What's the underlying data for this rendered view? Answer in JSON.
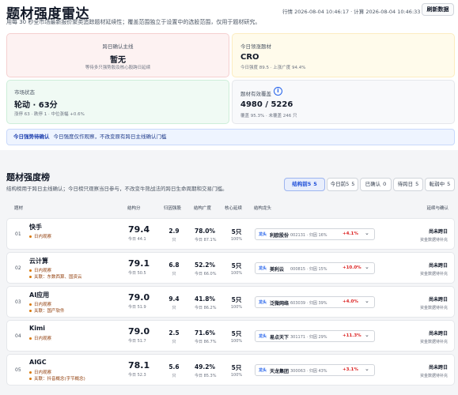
{
  "header": {
    "title": "题材强度雷达",
    "subtitle": "用每 30 秒全市场最新报价聚类追踪题材延续性；覆盖范围独立于设置中的选股范围，仅用于题材研究。",
    "meta": "行情 2026-08-04 10:46:17 · 计算 2026-08-04 10:46:33",
    "refresh_label": "刷新数据"
  },
  "cards": {
    "main_line": {
      "label": "跨日确认主线",
      "value": "暂无",
      "sub": "等待多只强势股及核心股跨日延续"
    },
    "leader": {
      "label": "今日领涨题材",
      "value": "CRO",
      "sub": "今日强度 89.5 · 上涨广度 94.4%"
    },
    "market": {
      "label": "市场状态",
      "value": "轮动 · 63分",
      "sub": "涨停 63 · 跌停 1 · 中位涨幅 +0.6%"
    },
    "coverage": {
      "label": "题材有效覆盖",
      "info_icon": "i",
      "value": "4980 / 5226",
      "sub": "覆盖 95.3% · 未覆盖 246 只"
    }
  },
  "notice": {
    "bold": "今日强势待确认",
    "text": "今日强度仅作观察，不改变原有跨日主线确认门槛"
  },
  "ranking": {
    "title": "题材强度榜",
    "subtitle": "结构榜用于跨日主线确认；今日榜只观察当日参与，不改变牛熊战法的跨日生命周期和交易门槛。",
    "tabs": [
      {
        "label": "结构前5",
        "count": "5",
        "active": true
      },
      {
        "label": "今日前5",
        "count": "5",
        "active": false
      },
      {
        "label": "已确认",
        "count": "0",
        "active": false
      },
      {
        "label": "待跨日",
        "count": "5",
        "active": false
      },
      {
        "label": "転弱中",
        "count": "5",
        "active": false
      }
    ],
    "columns": {
      "theme": "题材",
      "score": "结构分",
      "retention": "归因强股",
      "breadth": "结构广度",
      "continuation": "核心延续",
      "leader": "结构龙头",
      "status": "延续与确认"
    },
    "rows": [
      {
        "idx": "01",
        "name": "快手",
        "tags": [
          "日内观察"
        ],
        "score": "79.4",
        "score_today": "今日 44.1",
        "retention": "2.9",
        "retention_unit": "只",
        "breadth": "78.0%",
        "breadth_today": "今日 87.1%",
        "cont": "5只",
        "cont_sub": "100%",
        "leader_badge": "龙头",
        "leader_name": "利欧股份",
        "leader_meta": "002131 · 归因 16%",
        "leader_chg": "+4.1%",
        "status": "尚未跨日",
        "status_sub": "资金数据待补充"
      },
      {
        "idx": "02",
        "name": "云计算",
        "tags": [
          "日内观察",
          "关联：东数西算、国资云"
        ],
        "score": "79.1",
        "score_today": "今日 50.5",
        "retention": "6.8",
        "retention_unit": "只",
        "breadth": "52.2%",
        "breadth_today": "今日 66.0%",
        "cont": "5只",
        "cont_sub": "100%",
        "leader_badge": "龙头",
        "leader_name": "美利云",
        "leader_meta": "000815 · 归因 15%",
        "leader_chg": "+10.0%",
        "status": "尚未跨日",
        "status_sub": "资金数据待补充"
      },
      {
        "idx": "03",
        "name": "AI应用",
        "tags": [
          "日内观察",
          "关联：国产软件"
        ],
        "score": "79.0",
        "score_today": "今日 51.9",
        "retention": "9.4",
        "retention_unit": "只",
        "breadth": "41.8%",
        "breadth_today": "今日 86.2%",
        "cont": "5只",
        "cont_sub": "100%",
        "leader_badge": "龙头",
        "leader_name": "泛微网络",
        "leader_meta": "603039 · 归因 39%",
        "leader_chg": "+4.0%",
        "status": "尚未跨日",
        "status_sub": "资金数据待补充"
      },
      {
        "idx": "04",
        "name": "Kimi",
        "tags": [
          "日内观察"
        ],
        "score": "79.0",
        "score_today": "今日 51.7",
        "retention": "2.5",
        "retention_unit": "只",
        "breadth": "71.6%",
        "breadth_today": "今日 86.7%",
        "cont": "5只",
        "cont_sub": "100%",
        "leader_badge": "龙头",
        "leader_name": "易点天下",
        "leader_meta": "301171 · 归因 29%",
        "leader_chg": "+11.3%",
        "status": "尚未跨日",
        "status_sub": "资金数据待补充"
      },
      {
        "idx": "05",
        "name": "AIGC",
        "tags": [
          "日内观察",
          "关联：抖音概念(字节概念)"
        ],
        "score": "78.1",
        "score_today": "今日 52.3",
        "retention": "5.6",
        "retention_unit": "只",
        "breadth": "49.2%",
        "breadth_today": "今日 85.3%",
        "cont": "5只",
        "cont_sub": "100%",
        "leader_badge": "龙头",
        "leader_name": "天龙集团",
        "leader_meta": "300063 · 归因 43%",
        "leader_chg": "+3.1%",
        "status": "尚未跨日",
        "status_sub": "资金数据待补充"
      }
    ]
  }
}
